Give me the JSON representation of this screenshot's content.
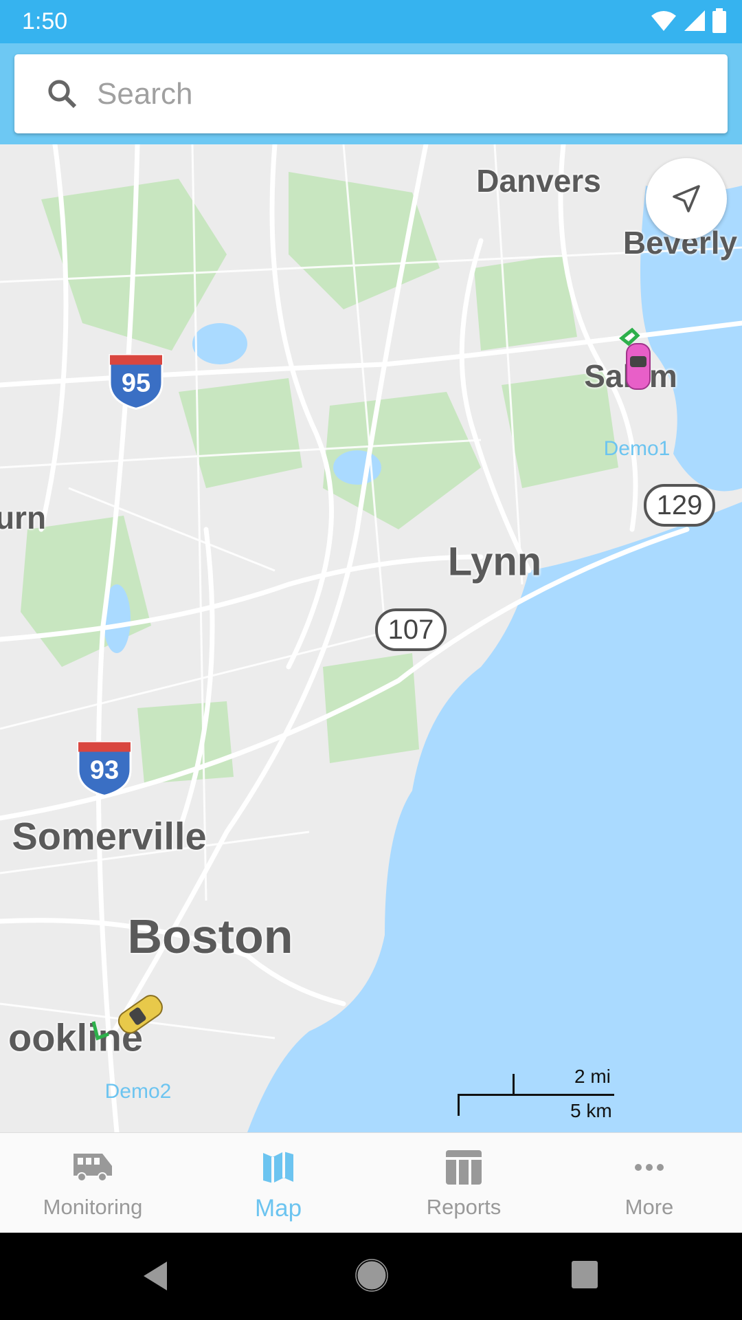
{
  "status_bar": {
    "time": "1:50",
    "icons": [
      "wifi-icon",
      "signal-icon",
      "battery-icon"
    ]
  },
  "search": {
    "placeholder": "Search",
    "value": ""
  },
  "map": {
    "places": {
      "danvers": "Danvers",
      "beverly": "Beverly",
      "salem": "Salem",
      "lynn": "Lynn",
      "woburn_partial": "urn",
      "somerville": "Somerville",
      "boston": "Boston",
      "brookline_partial": "ookline"
    },
    "routes": {
      "i95": "95",
      "i93": "93",
      "r129": "129",
      "r107": "107"
    },
    "vehicles": [
      {
        "name": "Demo1",
        "color": "#e85fc8"
      },
      {
        "name": "Demo2",
        "color": "#e8c94a"
      }
    ],
    "scale": {
      "imperial": "2 mi",
      "metric": "5 km"
    },
    "colors": {
      "water": "#aadaff",
      "park": "#c8e6c0",
      "land": "#ececec",
      "road": "#ffffff"
    }
  },
  "bottom_nav": {
    "items": [
      {
        "label": "Monitoring",
        "icon": "bus-icon"
      },
      {
        "label": "Map",
        "icon": "map-icon",
        "active": true
      },
      {
        "label": "Reports",
        "icon": "table-icon"
      },
      {
        "label": "More",
        "icon": "more-icon"
      }
    ],
    "active_color": "#6cc4f0"
  }
}
